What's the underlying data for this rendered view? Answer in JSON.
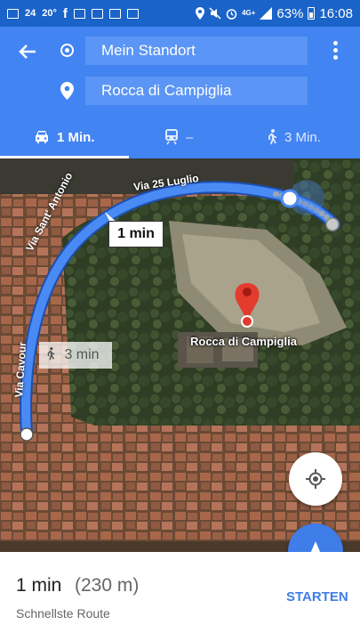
{
  "status_bar": {
    "notification_icons": [
      "mail-icon",
      "calendar-icon",
      "temperature-icon",
      "facebook-icon",
      "gmail-icon",
      "photos-icon",
      "gmail-icon",
      "briefcase-icon"
    ],
    "calendar_day": "24",
    "temperature": "20°",
    "battery_percent": "63%",
    "network": "4G+",
    "time": "16:08"
  },
  "header": {
    "origin_value": "Mein Standort",
    "destination_value": "Rocca di Campiglia",
    "accent_color": "#4284f2"
  },
  "modes": {
    "car": {
      "icon": "car-icon",
      "label": "1 Min.",
      "selected": true
    },
    "transit": {
      "icon": "train-icon",
      "label": "–"
    },
    "walk": {
      "icon": "walk-icon",
      "label": "3 Min."
    }
  },
  "map": {
    "streets": [
      "Via 25 Luglio",
      "Via Sant' Antonio",
      "Via Cavour"
    ],
    "route_time": "1 min",
    "walk_time": "3 min",
    "place_name": "Rocca di Campiglia",
    "route_color": "#4a8af4"
  },
  "bottom": {
    "duration": "1 min",
    "distance": "(230 m)",
    "route_desc": "Schnellste Route",
    "start_label": "STARTEN"
  }
}
